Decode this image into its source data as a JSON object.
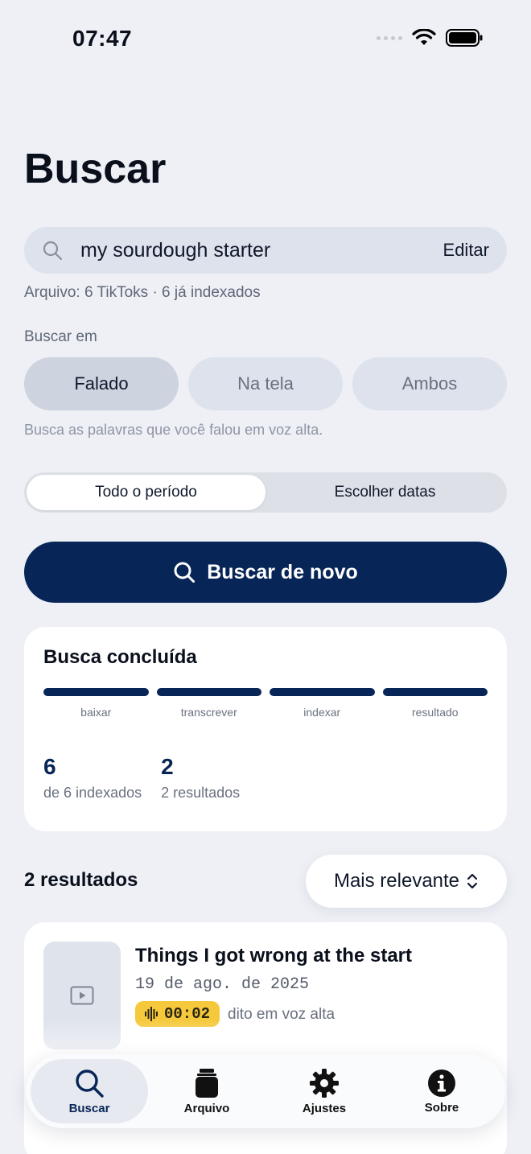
{
  "status_bar": {
    "time": "07:47"
  },
  "header": {
    "title": "Buscar"
  },
  "search": {
    "query": "my sourdough starter",
    "edit_label": "Editar",
    "archive_info": "Arquivo: 6 TikToks · 6 já indexados"
  },
  "search_in": {
    "label": "Buscar em",
    "options": [
      "Falado",
      "Na tela",
      "Ambos"
    ],
    "selected": "Falado",
    "hint": "Busca as palavras que você falou em voz alta."
  },
  "period": {
    "options": [
      "Todo o período",
      "Escolher datas"
    ],
    "selected": "Todo o período"
  },
  "search_again_label": "Buscar de novo",
  "progress": {
    "title": "Busca concluída",
    "stages": [
      "baixar",
      "transcrever",
      "indexar",
      "resultado"
    ],
    "stats": [
      {
        "value": "6",
        "caption": "de 6 indexados"
      },
      {
        "value": "2",
        "caption": "2 resultados"
      }
    ]
  },
  "results": {
    "count_label": "2 resultados",
    "sort_label": "Mais relevante",
    "items": [
      {
        "title": "Things I got wrong at the start",
        "date": "19 de ago. de 2025",
        "timestamp": "00:02",
        "source_note": "dito em voz alta"
      }
    ]
  },
  "tabbar": {
    "items": [
      "Buscar",
      "Arquivo",
      "Ajustes",
      "Sobre"
    ],
    "active": "Buscar"
  },
  "colors": {
    "accent": "#072556",
    "highlight": "#f5c93b",
    "background": "#eef0f6"
  }
}
